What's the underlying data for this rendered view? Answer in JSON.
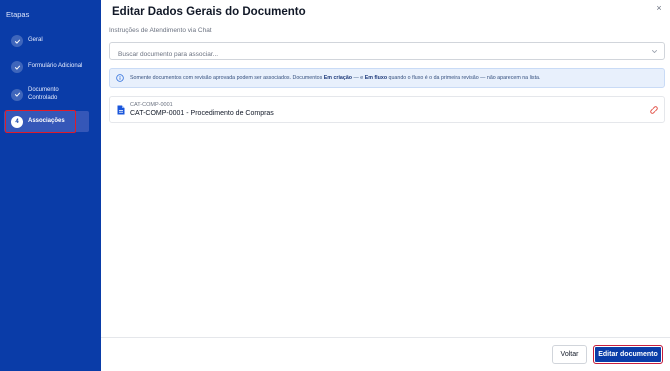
{
  "sidebar": {
    "title": "Etapas",
    "steps": [
      {
        "label": "Geral",
        "state": "done"
      },
      {
        "label": "Formulário Adicional",
        "state": "done"
      },
      {
        "label_line1": "Documento",
        "label_line2": "Controlado",
        "state": "done"
      },
      {
        "number": "4",
        "label": "Associações",
        "state": "active"
      }
    ]
  },
  "header": {
    "title": "Editar Dados Gerais do Documento",
    "close": "×",
    "subtitle": "Instruções de Atendimento via Chat"
  },
  "search": {
    "placeholder": "Buscar documento para associar..."
  },
  "info": {
    "part1": "Somente documentos com revisão aprovada podem ser associados. Documentos ",
    "bold1": "Em criação",
    "part2": " — e ",
    "bold2": "Em fluxo",
    "part3": " quando o fluxo é o da primeira revisão — não aparecem na lista."
  },
  "associated_documents": [
    {
      "code": "CAT-COMP-0001",
      "name": "CAT-COMP-0001 - Procedimento de Compras"
    }
  ],
  "footer": {
    "back_label": "Voltar",
    "submit_label": "Editar documento"
  },
  "colors": {
    "sidebar_bg": "#0a3ca8",
    "primary": "#0a3ca8",
    "highlight": "#e01b2a",
    "info_bg": "#e8f0fc",
    "unlink": "#e0453a"
  }
}
